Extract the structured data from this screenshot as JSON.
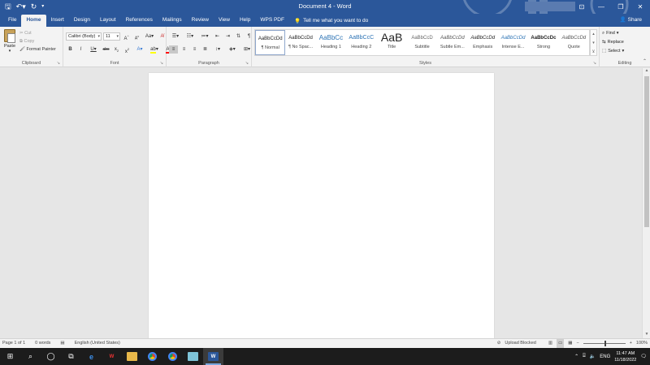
{
  "titlebar": {
    "title": "Document 4  -  Word",
    "qat": {
      "save_icon": "save-icon",
      "undo_icon": "undo-icon",
      "redo_icon": "redo-icon",
      "customize_icon": "customize-qat-icon"
    },
    "window_controls": {
      "ribbon_options": "ribbon-display-icon",
      "minimize": "minimize-icon",
      "restore": "restore-icon",
      "close": "close-icon"
    }
  },
  "tabs": [
    "File",
    "Home",
    "Insert",
    "Design",
    "Layout",
    "References",
    "Mailings",
    "Review",
    "View",
    "Help",
    "WPS PDF"
  ],
  "active_tab": "Home",
  "tell_me": "Tell me what you want to do",
  "share_label": "Share",
  "clipboard": {
    "paste_label": "Paste",
    "cut_label": "Cut",
    "copy_label": "Copy",
    "format_painter_label": "Format Painter",
    "group_label": "Clipboard"
  },
  "font": {
    "font_name": "Calibri (Body)",
    "font_size": "11",
    "group_label": "Font"
  },
  "paragraph": {
    "group_label": "Paragraph"
  },
  "styles": {
    "group_label": "Styles",
    "items": [
      {
        "sample": "AaBbCcDd",
        "name": "¶ Normal"
      },
      {
        "sample": "AaBbCcDd",
        "name": "¶ No Spac..."
      },
      {
        "sample": "AaBbCc",
        "name": "Heading 1"
      },
      {
        "sample": "AaBbCcC",
        "name": "Heading 2"
      },
      {
        "sample": "AaB",
        "name": "Title"
      },
      {
        "sample": "AaBbCcD",
        "name": "Subtitle"
      },
      {
        "sample": "AaBbCcDd",
        "name": "Subtle Em..."
      },
      {
        "sample": "AaBbCcDd",
        "name": "Emphasis"
      },
      {
        "sample": "AaBbCcDd",
        "name": "Intense E..."
      },
      {
        "sample": "AaBbCcDc",
        "name": "Strong"
      },
      {
        "sample": "AaBbCcDd",
        "name": "Quote"
      }
    ],
    "accent": "#2e74b5"
  },
  "editing": {
    "find_label": "Find",
    "replace_label": "Replace",
    "select_label": "Select",
    "group_label": "Editing"
  },
  "status": {
    "page": "Page 1 of 1",
    "words": "0 words",
    "language": "English (United States)",
    "upload": "Upload Blocked",
    "zoom": "100%",
    "zoom_fraction": 0.5
  },
  "taskbar": {
    "time": "11:47 AM",
    "date": "11/18/2022",
    "lang": "ENG"
  },
  "colors": {
    "brand": "#2b579a",
    "highlight": "#ffff00",
    "font_color": "#ff0000"
  }
}
